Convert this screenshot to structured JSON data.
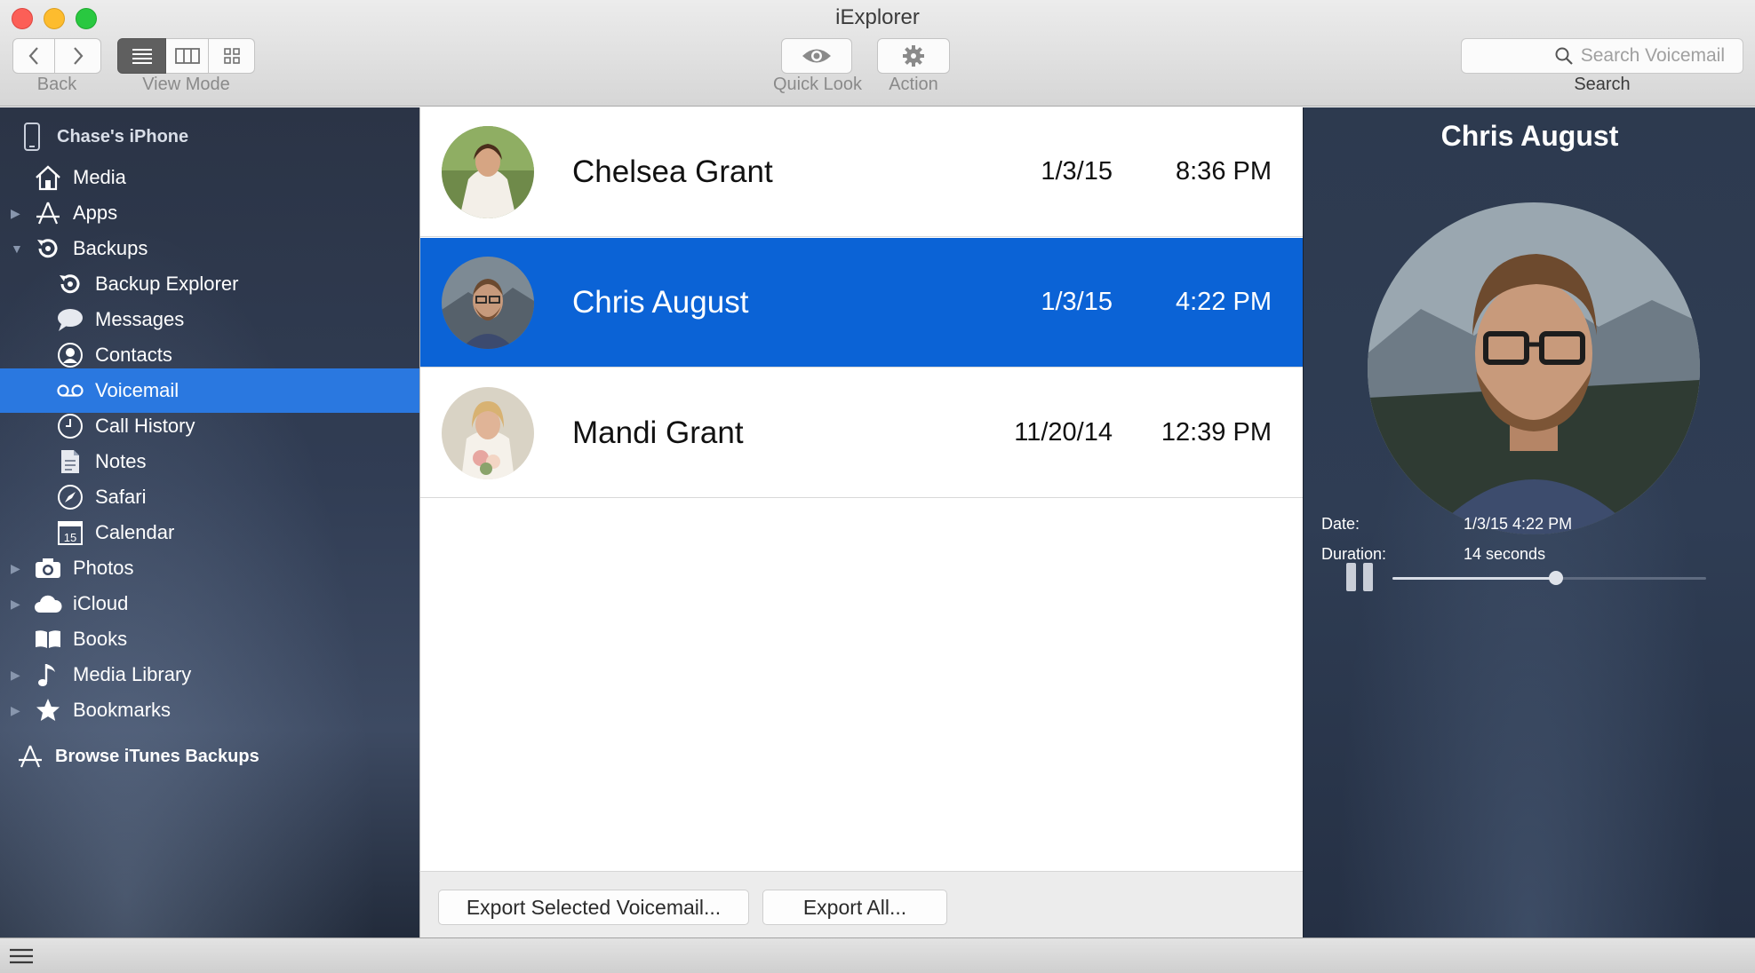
{
  "window": {
    "title": "iExplorer"
  },
  "toolbar": {
    "back_label": "Back",
    "view_mode_label": "View Mode",
    "quick_look_label": "Quick Look",
    "action_label": "Action",
    "search_placeholder": "Search Voicemail",
    "search_label": "Search"
  },
  "sidebar": {
    "device": "Chase's iPhone",
    "items": [
      {
        "label": "Media",
        "icon": "house-icon",
        "expandable": false
      },
      {
        "label": "Apps",
        "icon": "app-store-icon",
        "expandable": true
      },
      {
        "label": "Backups",
        "icon": "backup-icon",
        "expandable": true,
        "expanded": true
      },
      {
        "label": "Backup Explorer",
        "icon": "backup-icon"
      },
      {
        "label": "Messages",
        "icon": "speech-bubble-icon"
      },
      {
        "label": "Contacts",
        "icon": "contact-icon"
      },
      {
        "label": "Voicemail",
        "icon": "voicemail-icon",
        "selected": true
      },
      {
        "label": "Call History",
        "icon": "clock-icon"
      },
      {
        "label": "Notes",
        "icon": "notes-icon"
      },
      {
        "label": "Safari",
        "icon": "compass-icon"
      },
      {
        "label": "Calendar",
        "icon": "calendar-icon",
        "badge": "15"
      },
      {
        "label": "Photos",
        "icon": "camera-icon",
        "expandable": true
      },
      {
        "label": "iCloud",
        "icon": "cloud-icon",
        "expandable": true
      },
      {
        "label": "Books",
        "icon": "book-icon"
      },
      {
        "label": "Media Library",
        "icon": "music-note-icon",
        "expandable": true
      },
      {
        "label": "Bookmarks",
        "icon": "star-icon",
        "expandable": true
      }
    ],
    "browse_label": "Browse iTunes Backups"
  },
  "voicemails": [
    {
      "name": "Chelsea Grant",
      "date": "1/3/15",
      "time": "8:36 PM"
    },
    {
      "name": "Chris August",
      "date": "1/3/15",
      "time": "4:22 PM",
      "selected": true
    },
    {
      "name": "Mandi Grant",
      "date": "11/20/14",
      "time": "12:39 PM"
    }
  ],
  "buttons": {
    "export_selected": "Export Selected Voicemail...",
    "export_all": "Export All..."
  },
  "detail": {
    "name": "Chris August",
    "playback_progress": 0.52,
    "date_label": "Date:",
    "date_value": "1/3/15 4:22 PM",
    "duration_label": "Duration:",
    "duration_value": "14 seconds"
  },
  "colors": {
    "selection_blue": "#0b63d6",
    "sidebar_selection": "#2a78e0"
  }
}
